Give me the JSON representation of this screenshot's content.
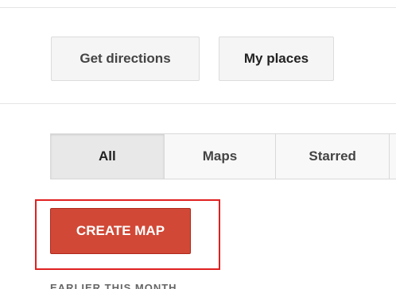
{
  "toolbar": {
    "get_directions_label": "Get directions",
    "my_places_label": "My places"
  },
  "tabs": [
    {
      "label": "All",
      "active": true
    },
    {
      "label": "Maps",
      "active": false
    },
    {
      "label": "Starred",
      "active": false
    }
  ],
  "create_map": {
    "label": "CREATE MAP"
  },
  "section": {
    "label": "EARLIER THIS MONTH"
  },
  "colors": {
    "create_button_bg": "#d14836",
    "highlight_border": "#e02020",
    "button_bg": "#f5f5f5"
  }
}
